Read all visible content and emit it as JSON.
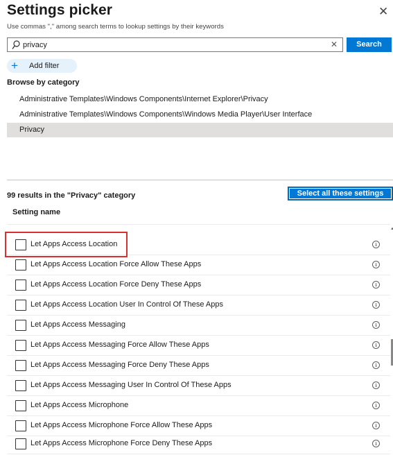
{
  "header": {
    "title": "Settings picker",
    "subtitle": "Use commas \",\" among search terms to lookup settings by their keywords",
    "close_icon": "close-icon"
  },
  "search": {
    "value": "privacy",
    "icon": "search-icon",
    "clear_icon": "clear-icon",
    "button_label": "Search"
  },
  "add_filter": {
    "label": "Add filter",
    "icon": "plus-icon"
  },
  "browse": {
    "heading": "Browse by category",
    "categories": [
      {
        "label": "Administrative Templates\\Windows Components\\Internet Explorer\\Privacy",
        "selected": false
      },
      {
        "label": "Administrative Templates\\Windows Components\\Windows Media Player\\User Interface",
        "selected": false
      },
      {
        "label": "Privacy",
        "selected": true
      }
    ]
  },
  "results": {
    "summary": "99 results in the \"Privacy\" category",
    "select_all_label": "Select all these settings",
    "column_header": "Setting name",
    "info_glyph": "i",
    "rows": [
      {
        "label": "Let Apps Access Location",
        "checked": false,
        "highlighted": true
      },
      {
        "label": "Let Apps Access Location Force Allow These Apps",
        "checked": false
      },
      {
        "label": "Let Apps Access Location Force Deny These Apps",
        "checked": false
      },
      {
        "label": "Let Apps Access Location User In Control Of These Apps",
        "checked": false
      },
      {
        "label": "Let Apps Access Messaging",
        "checked": false
      },
      {
        "label": "Let Apps Access Messaging Force Allow These Apps",
        "checked": false
      },
      {
        "label": "Let Apps Access Messaging Force Deny These Apps",
        "checked": false
      },
      {
        "label": "Let Apps Access Messaging User In Control Of These Apps",
        "checked": false
      },
      {
        "label": "Let Apps Access Microphone",
        "checked": false
      },
      {
        "label": "Let Apps Access Microphone Force Allow These Apps",
        "checked": false
      },
      {
        "label": "Let Apps Access Microphone Force Deny These Apps",
        "checked": false
      }
    ]
  },
  "colors": {
    "accent": "#0078d4",
    "selected_category_bg": "#e1dfdd",
    "highlight_border": "#d92f2f",
    "add_filter_bg": "#e5f1fb"
  }
}
